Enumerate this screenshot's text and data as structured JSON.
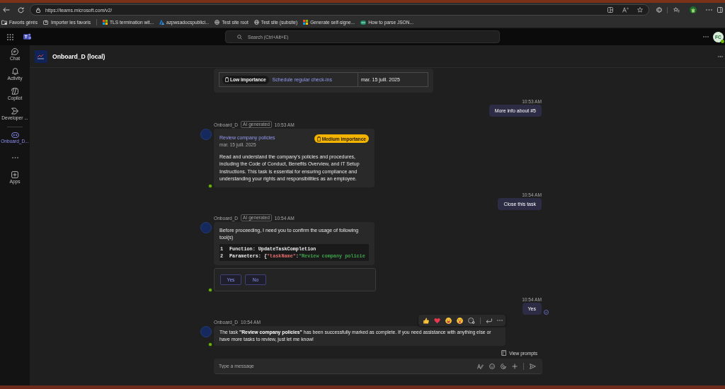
{
  "browser": {
    "url": "https://teams.microsoft.com/v2/",
    "bookmarks": [
      {
        "label": "Favoris gérés",
        "kind": "managed"
      },
      {
        "label": "Importer les favoris",
        "kind": "import"
      },
      {
        "label": "TLS termination wit...",
        "kind": "microsoft"
      },
      {
        "label": "azpwsadocspublici...",
        "kind": "azure"
      },
      {
        "label": "Test site root",
        "kind": "globe"
      },
      {
        "label": "Test site (subsite)",
        "kind": "globe"
      },
      {
        "label": "Generate self-signe...",
        "kind": "microsoft"
      },
      {
        "label": "How to parse JSON...",
        "kind": "eye"
      }
    ]
  },
  "teams_bar": {
    "search": {
      "placeholder": "Search (Ctrl+Alt+E)"
    },
    "avatar_initials": "FC"
  },
  "rail": {
    "items": [
      {
        "label": "Chat",
        "kind": "chat",
        "selected": false
      },
      {
        "label": "Activity",
        "kind": "bell",
        "selected": false
      },
      {
        "label": "Copilot",
        "kind": "swirl",
        "selected": false
      },
      {
        "label": "Developer ...",
        "kind": "developer",
        "selected": false
      },
      {
        "kind": "divider"
      },
      {
        "label": "Onboard_D...",
        "kind": "bot",
        "selected": true
      },
      {
        "kind": "more",
        "selected": false
      },
      {
        "label": "Apps",
        "kind": "apps",
        "selected": false
      }
    ]
  },
  "chat": {
    "title": "Onboard_D (local)",
    "messages": [
      {
        "kind": "task_table",
        "rows": [
          {
            "badge": {
              "label": "Low importance",
              "kind": "low"
            },
            "title": "Schedule regular check-ins",
            "date": "mar. 15 juill. 2025"
          }
        ]
      },
      {
        "kind": "user",
        "time": "10:53 AM",
        "text": "More info about #5",
        "seen": false
      },
      {
        "kind": "task_card",
        "sender": "Onboard_D",
        "ai_label": "AI generated",
        "time": "10:53 AM",
        "title": "Review company policies",
        "date": "mar. 15 juill. 2025",
        "badge": {
          "label": "Medium importance",
          "kind": "medium"
        },
        "body": "Read and understand the company's policies and procedures, including the Code of Conduct, Benefits Overview, and IT Setup Instructions. This task is essential for ensuring compliance and understanding your rights and responsibilities as an employee."
      },
      {
        "kind": "user",
        "time": "10:54 AM",
        "text": "Close this task",
        "seen": false
      },
      {
        "kind": "tool_confirm",
        "sender": "Onboard_D",
        "ai_label": "AI generated",
        "time": "10:54 AM",
        "text": "Before proceeding, I need you to confirm the usage of following tool(s)",
        "code": [
          {
            "number": "1",
            "tokens": [
              {
                "text": "Function: UpdateTaskCompletion",
                "kind": "plain"
              }
            ]
          },
          {
            "number": "2",
            "tokens": [
              {
                "text": "Parameters: {",
                "kind": "plain"
              },
              {
                "text": "\"taskName\"",
                "kind": "key"
              },
              {
                "text": ":",
                "kind": "plain"
              },
              {
                "text": "\"Review company policie",
                "kind": "string"
              }
            ]
          }
        ],
        "actions": [
          "Yes",
          "No"
        ]
      },
      {
        "kind": "user",
        "time": "10:54 AM",
        "text": "Yes",
        "seen": true
      },
      {
        "kind": "text",
        "sender": "Onboard_D",
        "time": "10:54 AM",
        "text": "The task **\"Review company policies\"** has been successfully marked as complete. If you need assistance with anything else or have more tasks to review, just let me know!",
        "hovered": true
      }
    ],
    "prompts_label": "View prompts",
    "compose": {
      "placeholder": "Type a message"
    }
  }
}
